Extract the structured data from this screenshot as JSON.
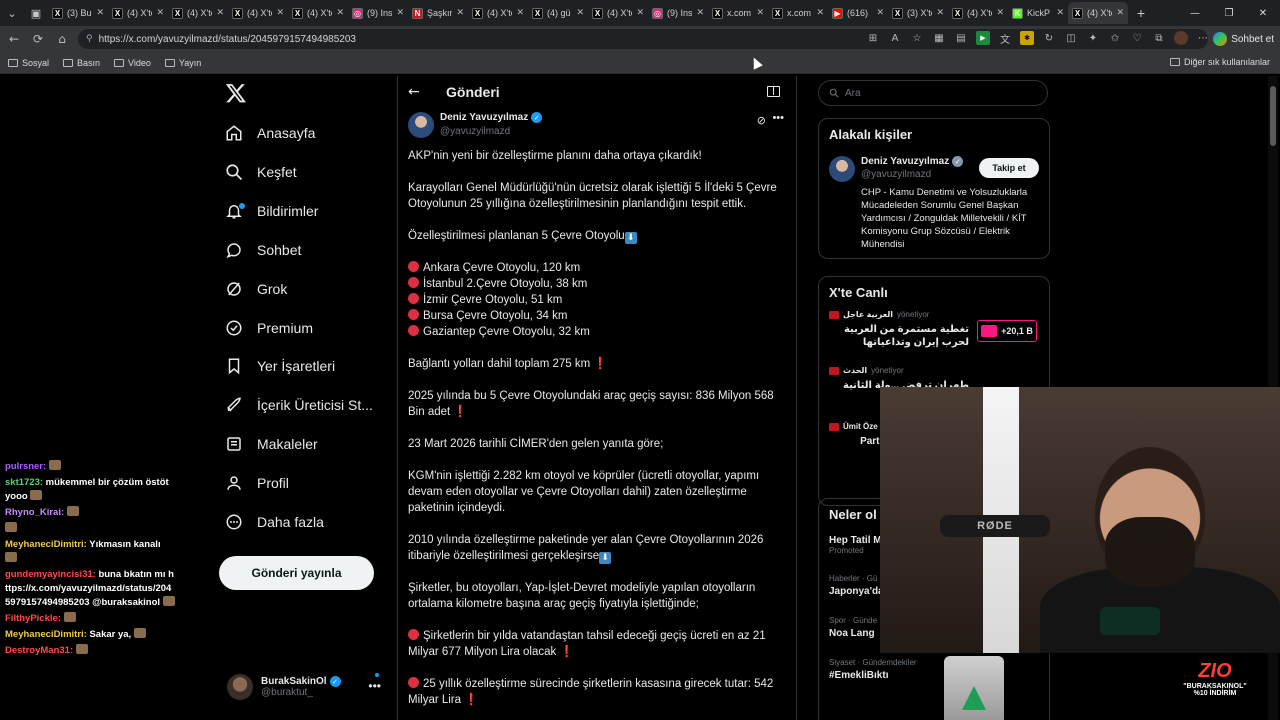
{
  "browser": {
    "tabs": [
      {
        "title": "(3) Bu",
        "icon": "x-icon"
      },
      {
        "title": "(4) X'te",
        "icon": "x-icon"
      },
      {
        "title": "(4) X'te",
        "icon": "x-icon"
      },
      {
        "title": "(4) X'te",
        "icon": "x-icon"
      },
      {
        "title": "(4) X'te",
        "icon": "x-icon"
      },
      {
        "title": "(9) Ins",
        "icon": "instagram-icon"
      },
      {
        "title": "Şaşkın",
        "icon": "news-icon"
      },
      {
        "title": "(4) X'te",
        "icon": "x-icon"
      },
      {
        "title": "(4) gü",
        "icon": "x-icon"
      },
      {
        "title": "(4) X'te",
        "icon": "x-icon"
      },
      {
        "title": "(9) Ins",
        "icon": "instagram-icon"
      },
      {
        "title": "x.com",
        "icon": "x-icon"
      },
      {
        "title": "x.com",
        "icon": "x-icon"
      },
      {
        "title": "(616)",
        "icon": "youtube-icon"
      },
      {
        "title": "(3) X'te",
        "icon": "x-icon"
      },
      {
        "title": "(4) X'te",
        "icon": "x-icon"
      },
      {
        "title": "KickP",
        "icon": "kick-icon"
      },
      {
        "title": "(4) X'te",
        "icon": "x-icon"
      }
    ],
    "url": "https://x.com/yavuzyilmazd/status/2045979157494985203",
    "chat_button": "Sohbet et",
    "bookmarks": [
      "Sosyal",
      "Basın",
      "Video",
      "Yayın"
    ],
    "other_bookmarks": "Diğer sık kullanılanlar"
  },
  "nav": {
    "items": [
      {
        "label": "Anasayfa",
        "icon": "home-icon"
      },
      {
        "label": "Keşfet",
        "icon": "search-icon"
      },
      {
        "label": "Bildirimler",
        "icon": "bell-icon"
      },
      {
        "label": "Sohbet",
        "icon": "chat-icon"
      },
      {
        "label": "Grok",
        "icon": "grok-icon"
      },
      {
        "label": "Premium",
        "icon": "premium-icon"
      },
      {
        "label": "Yer İşaretleri",
        "icon": "bookmark-icon"
      },
      {
        "label": "İçerik Üreticisi St...",
        "icon": "rocket-icon"
      },
      {
        "label": "Makaleler",
        "icon": "article-icon"
      },
      {
        "label": "Profil",
        "icon": "profile-icon"
      },
      {
        "label": "Daha fazla",
        "icon": "more-circle-icon"
      }
    ],
    "post_button": "Gönderi yayınla",
    "account": {
      "name": "BurakSakinOl",
      "handle": "@buraktut_"
    }
  },
  "main": {
    "title": "Gönderi",
    "author": {
      "name": "Deniz Yavuzyılmaz",
      "handle": "@yavuzyilmazd"
    },
    "paragraphs": [
      "AKP'nin yeni bir özelleştirme planını daha ortaya çıkardık!",
      "Karayolları Genel Müdürlüğü'nün ücretsiz olarak işlettiği 5 İl'deki 5 Çevre Otoyolunun 25 yıllığına özelleştirilmesinin planlandığını tespit ettik.",
      "Özelleştirilmesi planlanan 5 Çevre Otoyolu"
    ],
    "list": [
      "Ankara Çevre Otoyolu, 120 km",
      "İstanbul 2.Çevre Otoyolu, 38 km",
      "İzmir Çevre Otoyolu, 51 km",
      "Bursa Çevre Otoyolu, 34 km",
      "Gaziantep Çevre Otoyolu, 32 km"
    ],
    "p_total": "Bağlantı yolları dahil toplam 275 km",
    "p_2025": "2025 yılında bu 5 Çevre Otoyolundaki araç geçiş sayısı: 836 Milyon 568 Bin adet",
    "p_cimer": "23 Mart 2026 tarihli CİMER'den gelen yanıta göre;",
    "p_kgm": "KGM'nin işlettiği 2.282 km otoyol ve köprüler (ücretli otoyollar, yapımı devam eden otoyollar ve Çevre Otoyolları dahil) zaten özelleştirme paketinin içindeydi.",
    "p_2010": "2010 yılında özelleştirme paketinde yer alan Çevre Otoyollarının 2026 itibariyle özelleştirilmesi gerçekleşirse",
    "p_sirketler": "Şirketler, bu otoyolları, Yap-İşlet-Devret modeliyle yapılan otoyolların ortalama kilometre başına araç geçiş fiyatıyla işlettiğinde;",
    "p_bir_yil": "Şirketlerin bir yılda vatandaştan tahsil edeceği geçiş ücreti en az 21 Milyar 677 Milyon Lira olacak",
    "p_25_yil": "25 yıllık özelleştirme sürecinde şirketlerin kasasına girecek tutar: 542 Milyar Lira"
  },
  "right": {
    "search_placeholder": "Ara",
    "related": {
      "title": "Alakalı kişiler",
      "name": "Deniz Yavuzyılmaz",
      "handle": "@yavuzyilmazd",
      "follow": "Takip et",
      "bio": "CHP - Kamu Denetimi ve Yolsuzluklarla Mücadeleden Sorumlu Genel Başkan Yardımcısı / Zonguldak Milletvekili / KİT Komisyonu Grup Sözcüsü / Elektrik Mühendisi"
    },
    "live": {
      "title": "X'te Canlı",
      "items": [
        {
          "source": "العربية عاجل",
          "managed": "yönetiyor",
          "text": "تغطية مستمرة من العربية لحرب إيران وتداعياتها",
          "count": "+20,1 B"
        },
        {
          "source": "الحدث",
          "managed": "yönetiyor",
          "text": "طهران ترفض ...ولة الثانية من",
          "count": ""
        },
        {
          "source": "Ümit Öze",
          "managed": "",
          "text": "Parti Sözcü Karamahm",
          "count": ""
        }
      ]
    },
    "trends": {
      "title": "Neler ol",
      "items": [
        {
          "meta": "",
          "name": "Hep Tatil M",
          "extra": "Promoted"
        },
        {
          "meta": "Haberler · Gü",
          "name": "Japonya'da",
          "extra": ""
        },
        {
          "meta": "Spor · Günde",
          "name": "Noa Lang",
          "extra": ""
        },
        {
          "meta": "Siyaset · Gündemdekiler",
          "name": "#EmekliBıktı",
          "extra": ""
        }
      ]
    }
  },
  "chat": {
    "messages": [
      {
        "user": "pulrsner:",
        "text": "",
        "color": "#b05cff"
      },
      {
        "user": "skt1723:",
        "text": "mükemmel bir çözüm östöt yooo",
        "color": "#5ad36b"
      },
      {
        "user": "Rhyno_Kirai:",
        "text": "",
        "color": "#c58bff"
      },
      {
        "user": "",
        "text": "",
        "color": "#ffffff"
      },
      {
        "user": "MeyhaneciDimitri:",
        "text": "Yıkmasın kanalı",
        "color": "#f2c94c"
      },
      {
        "user": "gundemyayincisi31:",
        "text": "buna bkatın mı https://x.com/yavuzyilmazd/status/2045979157494985203 @buraksakinol",
        "color": "#ff4a4a"
      },
      {
        "user": "FilthyPickle:",
        "text": "",
        "color": "#ff4a4a"
      },
      {
        "user": "MeyhaneciDimitri:",
        "text": "Sakar ya,",
        "color": "#f2c94c"
      },
      {
        "user": "DestroyMan31:",
        "text": "",
        "color": "#ff4a4a"
      }
    ]
  },
  "stream": {
    "mic_brand": "RØDE",
    "promo_logo": "ZIO",
    "promo_code": "\"BURAKSAKINOL\"",
    "promo_discount": "%10 İNDİRİM"
  }
}
